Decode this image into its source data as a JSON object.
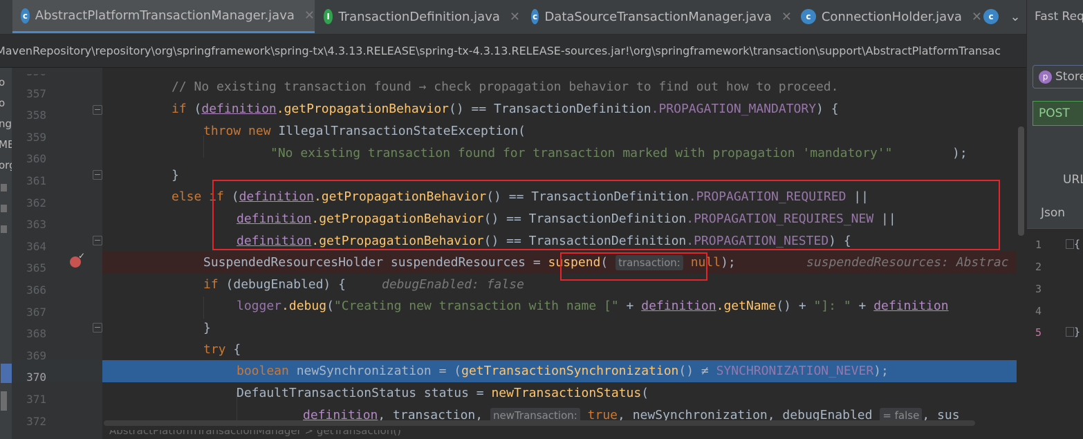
{
  "tabs": [
    {
      "label": "AbstractPlatformTransactionManager.java",
      "icon": "class-icon",
      "active": true
    },
    {
      "label": "TransactionDefinition.java",
      "icon": "interface-icon",
      "active": false
    },
    {
      "label": "DataSourceTransactionManager.java",
      "icon": "class-icon",
      "active": false
    },
    {
      "label": "ConnectionHolder.java",
      "icon": "class-icon",
      "active": false
    }
  ],
  "tab_close": "✕",
  "tab_overflow": "⌄",
  "breadcrumb_path": "MavenRepository\\repository\\org\\springframework\\spring-tx\\4.3.13.RELEASE\\spring-tx-4.3.13.RELEASE-sources.jar!\\org\\springframework\\transaction\\support\\AbstractPlatformTransac",
  "left_strip": [
    "o",
    "o",
    "ng",
    "ME",
    "org"
  ],
  "gutter": {
    "line_numbers": [
      "356",
      "357",
      "358",
      "359",
      "360",
      "361",
      "362",
      "363",
      "364",
      "365",
      "366",
      "367",
      "368",
      "369",
      "370",
      "371",
      "372"
    ],
    "current_line": "370",
    "breakpoint_line": "365"
  },
  "code": {
    "l357_comment": "// No existing transaction found → check propagation behavior to find out how to proceed.",
    "if": "if",
    "else": "else",
    "throw": "throw",
    "new": "new",
    "try": "try",
    "boolean": "boolean",
    "definition": "definition",
    "getPropagationBehavior": ".getPropagationBehavior",
    "eq": " == ",
    "TransactionDefinition": "TransactionDefinition",
    "PROPAGATION_MANDATORY": ".PROPAGATION_MANDATORY",
    "PROPAGATION_REQUIRED": ".PROPAGATION_REQUIRED",
    "PROPAGATION_REQUIRES_NEW": ".PROPAGATION_REQUIRES_NEW",
    "PROPAGATION_NESTED": ".PROPAGATION_NESTED",
    "IllegalTransactionStateException": "IllegalTransactionStateException(",
    "mandatory_msg": "\"No existing transaction found for transaction marked with propagation 'mandatory'\"",
    "SuspendedResourcesHolder": "SuspendedResourcesHolder suspendedResources ",
    "suspend": "suspend",
    "hint_transaction": "transaction:",
    "null": "null",
    "inline_suspended": "suspendedResources: Abstrac",
    "debugEnabled": "debugEnabled",
    "inline_debug": "debugEnabled: false",
    "logger": "logger",
    "debug": ".debug",
    "creating_msg": "\"Creating new transaction with name [\"",
    "getName": ".getName",
    "colon_msg": "\"]: \"",
    "newSynchronization": " newSynchronization = (",
    "getTransactionSynchronization": "getTransactionSynchronization",
    "neq": " ≠ ",
    "SYNCHRONIZATION_NEVER": "SYNCHRONIZATION_NEVER",
    "DefaultTransactionStatus": "DefaultTransactionStatus status = ",
    "newTransactionStatus": "newTransactionStatus",
    "l372_a": ", transaction, ",
    "hint_newTransaction": "newTransaction:",
    "true": "true",
    "l372_b": ", newSynchronization, debugEnabled ",
    "hint_false": "= false",
    "l372_c": ", sus"
  },
  "right_panel": {
    "title": "Fast Req",
    "store_label": "Store",
    "store_icon_letter": "p",
    "method": "POST",
    "url_label": "URL",
    "json_label": "Json",
    "json_lines": [
      "1",
      "2",
      "3",
      "4",
      "5"
    ],
    "json_open": "{",
    "json_close": "}"
  },
  "bottom_breadcrumb": "AbstractPlatformTransactionManager > getTransaction()",
  "colors": {
    "keyword": "#cc7832",
    "string": "#6a8759",
    "constant": "#9876aa",
    "method": "#ffc66d",
    "highlight": "#e5252a",
    "selection": "#2d6099"
  }
}
